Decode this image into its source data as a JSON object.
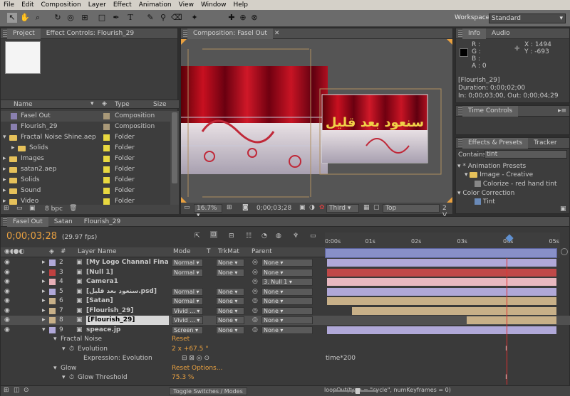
{
  "menu": [
    "File",
    "Edit",
    "Composition",
    "Layer",
    "Effect",
    "Animation",
    "View",
    "Window",
    "Help"
  ],
  "workspace": {
    "label": "Workspace:",
    "value": "Standard"
  },
  "project": {
    "tabs": [
      "Project",
      "Effect Controls: Flourish_29"
    ],
    "columns": [
      "Name",
      "Type",
      "Size"
    ],
    "items": [
      {
        "name": "Fasel Out",
        "type": "Composition",
        "kind": "comp",
        "color": "#a89878",
        "indent": 0
      },
      {
        "name": "Flourish_29",
        "type": "Composition",
        "kind": "comp",
        "color": "#a89878",
        "indent": 0
      },
      {
        "name": "Fractal Noise Shine.aep",
        "type": "Folder",
        "kind": "folder",
        "color": "#e8d840",
        "indent": 0
      },
      {
        "name": "Solids",
        "type": "Folder",
        "kind": "folder",
        "color": "#e8d840",
        "indent": 1
      },
      {
        "name": "Images",
        "type": "Folder",
        "kind": "folder",
        "color": "#e8d840",
        "indent": 0
      },
      {
        "name": "satan2.aep",
        "type": "Folder",
        "kind": "folder",
        "color": "#e8d840",
        "indent": 0
      },
      {
        "name": "Solids",
        "type": "Folder",
        "kind": "folder",
        "color": "#e8d840",
        "indent": 0
      },
      {
        "name": "Sound",
        "type": "Folder",
        "kind": "folder",
        "color": "#e8d840",
        "indent": 0
      },
      {
        "name": "Video",
        "type": "Folder",
        "kind": "folder",
        "color": "#e8d840",
        "indent": 0
      }
    ],
    "bpc": "8 bpc"
  },
  "comp": {
    "tab": "Composition: Fasel Out",
    "zoom": "16.7%",
    "timecode": "0;00;03;28",
    "resolution": "Third",
    "view": "Top",
    "views_count": "2 V"
  },
  "info": {
    "tabs": [
      "Info",
      "Audio"
    ],
    "r": "R :",
    "g": "G :",
    "b": "B :",
    "a": "A : 0",
    "x": "X : 1494",
    "y": "Y : -693",
    "layer": "[Flourish_29]",
    "duration": "Duration: 0;00;02;00",
    "inout": "In: 0;00;03;00, Out: 0;00;04;29"
  },
  "time_controls": {
    "tab": "Time Controls"
  },
  "effects": {
    "tabs": [
      "Effects & Presets",
      "Tracker"
    ],
    "contains_label": "Contains:",
    "contains_value": "tint",
    "tree": [
      "* Animation Presets",
      "Image - Creative",
      "Colorize - red hand tint",
      "Color Correction",
      "Tint"
    ]
  },
  "timeline": {
    "tabs": [
      "Fasel Out",
      "Satan",
      "Flourish_29"
    ],
    "timecode": "0;00;03;28",
    "fps": "(29.97 fps)",
    "headers": {
      "num": "#",
      "layer": "Layer Name",
      "mode": "Mode",
      "t": "T",
      "trkmat": "TrkMat",
      "parent": "Parent"
    },
    "ruler": [
      "0:00s",
      "01s",
      "02s",
      "03s",
      "04s",
      "05s"
    ],
    "layers": [
      {
        "num": "2",
        "name": "[My Logo Channal Final c",
        "mode": "Normal",
        "trkmat": "None",
        "parent": "None",
        "color": "#b0a8d8",
        "bar": "#b0a8d8"
      },
      {
        "num": "3",
        "name": "[Null 1]",
        "mode": "Normal",
        "trkmat": "None",
        "parent": "None",
        "color": "#c04040",
        "bar": "#c04848"
      },
      {
        "num": "4",
        "name": "Camera1",
        "mode": "",
        "trkmat": "",
        "parent": "3. Null 1",
        "color": "#e8b0b8",
        "bar": "#e8b8c0"
      },
      {
        "num": "5",
        "name": "[سنعود بعد قليل.psd]",
        "mode": "Normal",
        "trkmat": "None",
        "parent": "None",
        "color": "#b0a8d8",
        "bar": "#b0a8d8"
      },
      {
        "num": "6",
        "name": "[Satan]",
        "mode": "Normal",
        "trkmat": "None",
        "parent": "None",
        "color": "#c8b088",
        "bar": "#c8b088"
      },
      {
        "num": "7",
        "name": "[Flourish_29]",
        "mode": "Vivid ...",
        "trkmat": "None",
        "parent": "None",
        "color": "#c8b088",
        "bar": "#c8b088"
      },
      {
        "num": "8",
        "name": "[Flourish_29]",
        "mode": "Vivid ...",
        "trkmat": "None",
        "parent": "None",
        "color": "#c8b088",
        "bar": "#c8b088"
      },
      {
        "num": "9",
        "name": "speace.jp",
        "mode": "Screen",
        "trkmat": "None",
        "parent": "None",
        "color": "#b0a8d8",
        "bar": "#b0a8d8"
      }
    ],
    "props": [
      {
        "label": "Fractal Noise",
        "value": "Reset",
        "extra": ""
      },
      {
        "label": "Evolution",
        "value": "2 x +67.5 °",
        "extra": ""
      },
      {
        "label": "Expression: Evolution",
        "value": "",
        "extra": "time*200"
      },
      {
        "label": "Glow",
        "value": "Reset",
        "extra": "Options..."
      },
      {
        "label": "Glow Threshold",
        "value": "75.3 %",
        "extra": ""
      }
    ],
    "toggle": "Toggle Switches / Modes",
    "expr_text": "loopOut(type = \"cycle\", numKeyframes = 0)"
  },
  "colors": {
    "accent": "#e8a040",
    "playhead": "#e03030",
    "workarea": "#8890c8"
  }
}
